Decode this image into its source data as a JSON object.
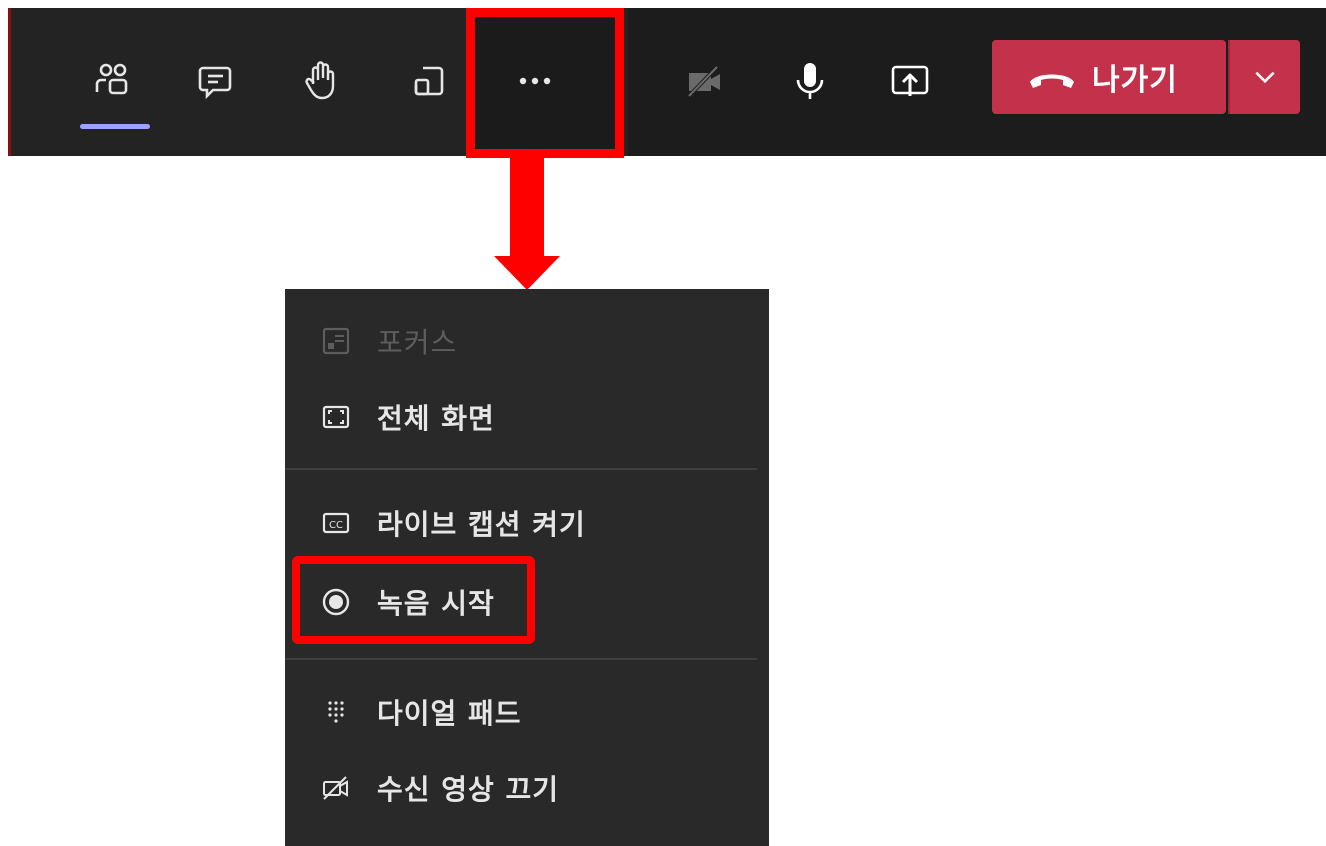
{
  "toolbar": {
    "buttons": [
      {
        "name": "participants-icon",
        "active": true
      },
      {
        "name": "chat-icon"
      },
      {
        "name": "raise-hand-icon"
      },
      {
        "name": "rooms-icon"
      },
      {
        "name": "more-actions-icon"
      },
      {
        "name": "camera-off-icon"
      },
      {
        "name": "microphone-icon"
      },
      {
        "name": "share-screen-icon"
      }
    ],
    "leave_label": "나가기",
    "leave_color": "#c4314b",
    "accent_color": "#9ea2ff"
  },
  "annotation": {
    "highlight_color": "#ff0000"
  },
  "menu": {
    "items": [
      {
        "label": "포커스",
        "icon": "focus-icon",
        "disabled": true
      },
      {
        "label": "전체 화면",
        "icon": "fullscreen-icon"
      },
      {
        "label": "라이브 캡션 켜기",
        "icon": "captions-icon"
      },
      {
        "label": "녹음 시작",
        "icon": "record-icon",
        "highlighted": true
      },
      {
        "label": "다이얼 패드",
        "icon": "dialpad-icon"
      },
      {
        "label": "수신 영상 끄기",
        "icon": "video-off-icon"
      }
    ]
  }
}
